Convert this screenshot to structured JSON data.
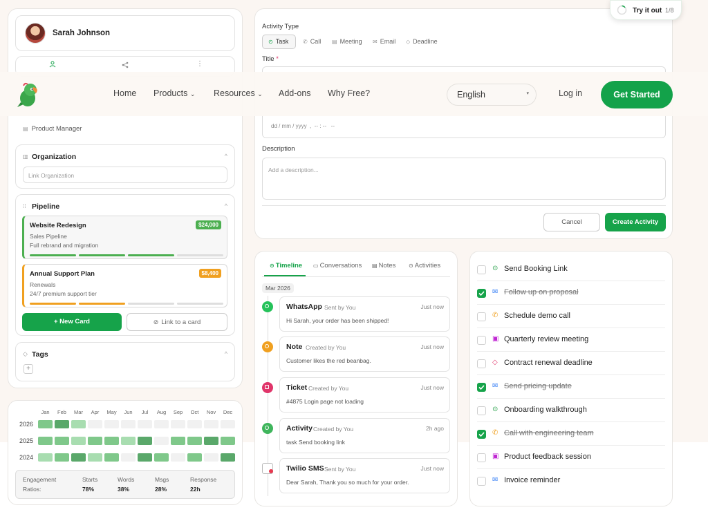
{
  "contact": {
    "name": "Sarah Johnson",
    "job_title": "Product Manager"
  },
  "organization": {
    "heading": "Organization",
    "placeholder": "Link Organization"
  },
  "pipeline": {
    "heading": "Pipeline",
    "deals": [
      {
        "title": "Website Redesign",
        "amount": "$24,000",
        "pipeline": "Sales Pipeline",
        "note": "Full rebrand and migration",
        "color": "#4caf50",
        "progress": 0.75
      },
      {
        "title": "Annual Support Plan",
        "amount": "$8,400",
        "pipeline": "Renewals",
        "note": "24/7 premium support tier",
        "color": "#f0a020",
        "progress": 0.5
      }
    ],
    "new_card": "+ New Card",
    "link_card": "Link to a card"
  },
  "tags": {
    "heading": "Tags",
    "add": "+"
  },
  "heatmap": {
    "months": [
      "Jan",
      "Feb",
      "Mar",
      "Apr",
      "May",
      "Jun",
      "Jul",
      "Aug",
      "Sep",
      "Oct",
      "Nov",
      "Dec"
    ],
    "rows": [
      {
        "year": "2026",
        "levels": [
          2,
          3,
          1,
          0,
          0,
          0,
          0,
          0,
          0,
          0,
          0,
          0
        ]
      },
      {
        "year": "2025",
        "levels": [
          2,
          2,
          1,
          2,
          2,
          1,
          3,
          0,
          2,
          2,
          3,
          2
        ]
      },
      {
        "year": "2024",
        "levels": [
          1,
          2,
          3,
          1,
          2,
          0,
          3,
          2,
          0,
          2,
          0,
          3
        ]
      }
    ],
    "level_colors": [
      "#f1f1f1",
      "#a8ddb0",
      "#7fc88a",
      "#5aa86a"
    ],
    "ratios": {
      "label_line1": "Engagement",
      "label_line2": "Ratios:",
      "cols": [
        {
          "label": "Starts",
          "value": "78%"
        },
        {
          "label": "Words",
          "value": "38%"
        },
        {
          "label": "Msgs",
          "value": "28%"
        },
        {
          "label": "Response",
          "value": "22h"
        }
      ]
    }
  },
  "activity_form": {
    "type_label": "Activity Type",
    "types": [
      "Task",
      "Call",
      "Meeting",
      "Email",
      "Deadline"
    ],
    "title_label": "Title",
    "required_mark": "*",
    "date_placeholder": "dd / mm / yyyy  ,  -- : --   --",
    "description_label": "Description",
    "description_placeholder": "Add a description...",
    "cancel": "Cancel",
    "create": "Create Activity"
  },
  "navbar": {
    "items": [
      "Home",
      "Products",
      "Resources",
      "Add-ons",
      "Why Free?"
    ],
    "language": "English",
    "login": "Log in",
    "cta": "Get Started"
  },
  "tryit": {
    "label": "Try it out",
    "progress": "1/8"
  },
  "timeline": {
    "tabs": [
      "Timeline",
      "Conversations",
      "Notes",
      "Activities"
    ],
    "month": "Mar 2026",
    "items": [
      {
        "title": "WhatsApp",
        "by": "Sent by You",
        "time": "Just now",
        "body": "Hi Sarah, your order has been shipped!",
        "color": "#25c25a"
      },
      {
        "title": "Note",
        "by": "Created by You",
        "time": "Just now",
        "body": "Customer likes the red beanbag.",
        "color": "#f0a020"
      },
      {
        "title": "Ticket",
        "by": "Created by You",
        "time": "Just now",
        "body": "#4875 Login page not loading",
        "color": "#e0356a"
      },
      {
        "title": "Activity",
        "by": "Created by You",
        "time": "2h ago",
        "body": "task Send booking link",
        "color": "#3fb55c"
      },
      {
        "title": "Twilio SMS",
        "by": "Sent by You",
        "time": "Just now",
        "body": "Dear Sarah, Thank you so much for your order.",
        "color": "#e8384f"
      }
    ]
  },
  "checklist": [
    {
      "label": "Send Booking Link",
      "done": false,
      "icon": "check-circle-icon",
      "icon_color": "#2ea44f"
    },
    {
      "label": "Follow up on proposal",
      "done": true,
      "icon": "mail-icon",
      "icon_color": "#3b82f6"
    },
    {
      "label": "Schedule demo call",
      "done": false,
      "icon": "phone-icon",
      "icon_color": "#f0a020"
    },
    {
      "label": "Quarterly review meeting",
      "done": false,
      "icon": "calendar-icon",
      "icon_color": "#c026d3"
    },
    {
      "label": "Contract renewal deadline",
      "done": false,
      "icon": "diamond-icon",
      "icon_color": "#e0356a"
    },
    {
      "label": "Send pricing update",
      "done": true,
      "icon": "mail-icon",
      "icon_color": "#3b82f6"
    },
    {
      "label": "Onboarding walkthrough",
      "done": false,
      "icon": "check-circle-icon",
      "icon_color": "#2ea44f"
    },
    {
      "label": "Call with engineering team",
      "done": true,
      "icon": "phone-icon",
      "icon_color": "#f0a020"
    },
    {
      "label": "Product feedback session",
      "done": false,
      "icon": "calendar-icon",
      "icon_color": "#c026d3"
    },
    {
      "label": "Invoice reminder",
      "done": false,
      "icon": "mail-icon",
      "icon_color": "#3b82f6"
    }
  ]
}
